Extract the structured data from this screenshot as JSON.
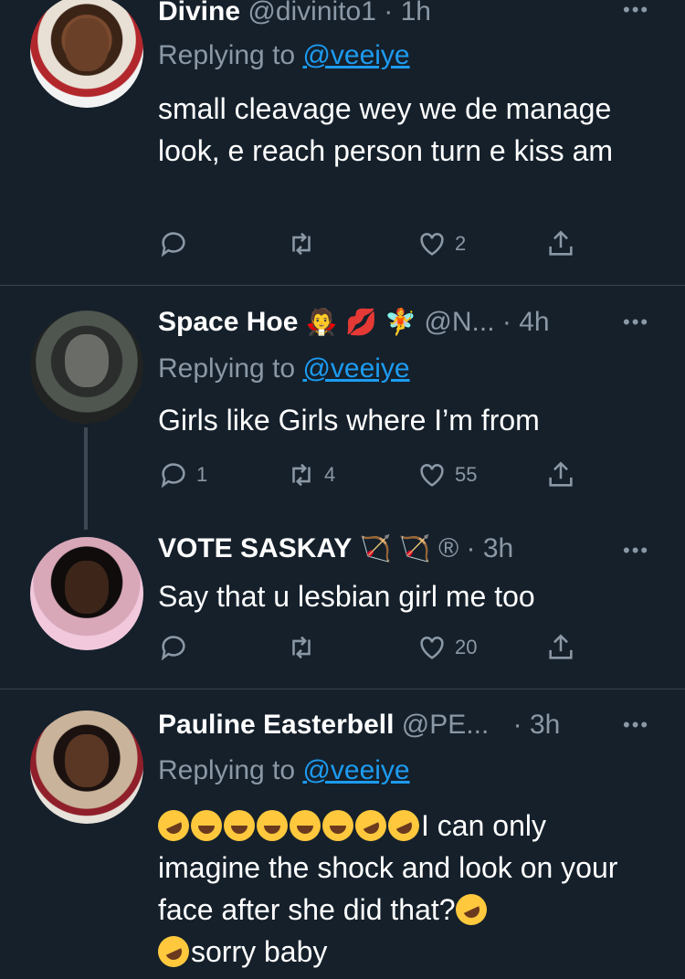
{
  "tweets": [
    {
      "name": "Divine",
      "handle": "@divinito1",
      "time": "· 1h",
      "replying_prefix": "Replying to",
      "replying_to": "@veeiye",
      "text": "small cleavage wey we de manage look, e reach person turn e kiss am",
      "actions": {
        "reply": "",
        "retweet": "",
        "like": "2"
      }
    },
    {
      "name": "Space Hoe",
      "name_emojis": [
        "vampire-emoji",
        "kiss-mark-emoji",
        "fairy-emoji"
      ],
      "handle": "@N...",
      "time": "· 4h",
      "replying_prefix": "Replying to",
      "replying_to": "@veeiye",
      "text": "Girls like Girls where I’m from",
      "actions": {
        "reply": "1",
        "retweet": "4",
        "like": "55"
      }
    },
    {
      "name": "VOTE SASKAY",
      "name_emojis": [
        "bow-and-arrow-emoji",
        "bow-and-arrow-emoji",
        "registered-emoji"
      ],
      "time": "· 3h",
      "text": "Say that u lesbian girl me too",
      "actions": {
        "reply": "",
        "retweet": "",
        "like": "20"
      }
    },
    {
      "name": "Pauline Easterbell",
      "handle": "@PE...",
      "time": "· 3h",
      "replying_prefix": "Replying to",
      "replying_to": "@veeiye",
      "text_line1": "I can only",
      "text_rest": "imagine the shock and look on your face after she did that?",
      "text_last": "sorry baby",
      "actions": {
        "reply": "",
        "retweet": "",
        "like": ""
      }
    }
  ],
  "more_label": "•••",
  "colors": {
    "background": "#15202b",
    "muted": "#8b98a5",
    "link": "#1d9bf0",
    "divider": "#38444d"
  }
}
